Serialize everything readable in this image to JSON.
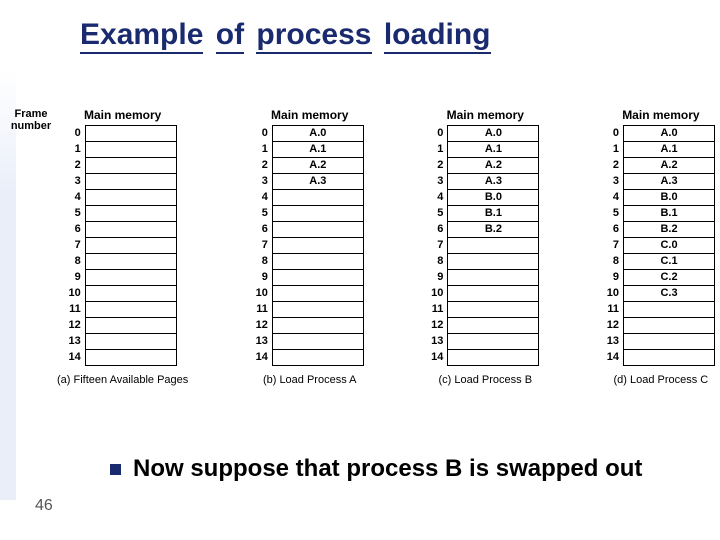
{
  "title_words": [
    "Example",
    "of",
    "process",
    "loading"
  ],
  "frame_label": [
    "Frame",
    "number"
  ],
  "frame_count": 15,
  "tables": [
    {
      "header": "Main memory",
      "caption": "(a) Fifteen Available Pages",
      "cells": [
        "",
        "",
        "",
        "",
        "",
        "",
        "",
        "",
        "",
        "",
        "",
        "",
        "",
        "",
        ""
      ]
    },
    {
      "header": "Main memory",
      "caption": "(b) Load Process A",
      "cells": [
        "A.0",
        "A.1",
        "A.2",
        "A.3",
        "",
        "",
        "",
        "",
        "",
        "",
        "",
        "",
        "",
        "",
        ""
      ]
    },
    {
      "header": "Main memory",
      "caption": "(c) Load Process B",
      "cells": [
        "A.0",
        "A.1",
        "A.2",
        "A.3",
        "B.0",
        "B.1",
        "B.2",
        "",
        "",
        "",
        "",
        "",
        "",
        "",
        ""
      ]
    },
    {
      "header": "Main memory",
      "caption": "(d) Load Process C",
      "cells": [
        "A.0",
        "A.1",
        "A.2",
        "A.3",
        "B.0",
        "B.1",
        "B.2",
        "C.0",
        "C.1",
        "C.2",
        "C.3",
        "",
        "",
        "",
        ""
      ]
    }
  ],
  "bullet_text": "Now suppose that process B is swapped out",
  "page_number": "46"
}
